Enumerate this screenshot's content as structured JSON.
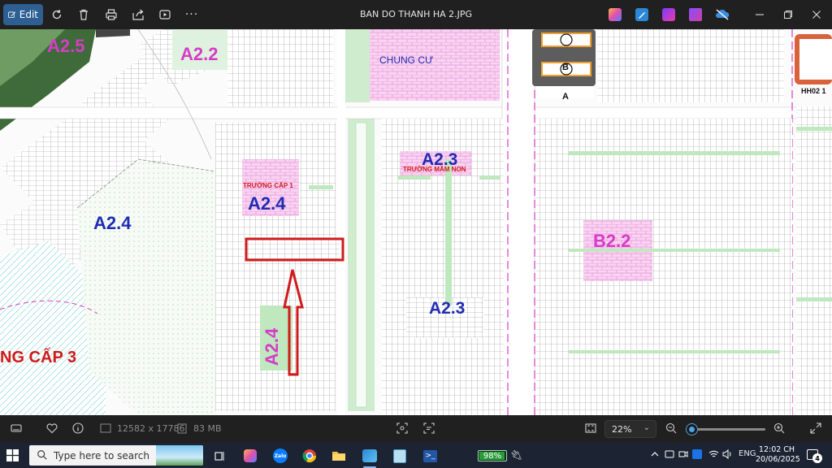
{
  "toolbar": {
    "edit_label": "Edit",
    "file_title": "BAN DO THANH HA 2.JPG",
    "tools": [
      "rotate-icon",
      "delete-icon",
      "print-icon",
      "share-icon",
      "slideshow-icon",
      "more-icon"
    ],
    "more_label": "···"
  },
  "map": {
    "zone_labels": [
      {
        "text": "A2.5",
        "color": "#d63cc7"
      },
      {
        "text": "A2.2",
        "color": "#d63cc7"
      },
      {
        "text": "CHUNG CƯ",
        "color": "#1f2bb3"
      },
      {
        "text": "A2.3",
        "color": "#1f2bb3"
      },
      {
        "text": "TRƯỜNG MẦM NON",
        "color": "#d11a1a"
      },
      {
        "text": "TRƯỜNG CẤP 1",
        "color": "#d11a1a"
      },
      {
        "text": "A2.4",
        "color": "#1f2bb3"
      },
      {
        "text": "A2.4",
        "color": "#1f2bb3"
      },
      {
        "text": "B2.2",
        "color": "#d63cc7"
      },
      {
        "text": "A2.3",
        "color": "#1f2bb3"
      },
      {
        "text": "A2.4",
        "color": "#d63cc7"
      },
      {
        "text": "NG CẤP 3",
        "color": "#d11a1a"
      }
    ],
    "buildings": {
      "b": "B",
      "a": "A",
      "hh": "HH02 1"
    }
  },
  "status": {
    "dimensions": "12582 x 17786",
    "file_size": "83 MB",
    "zoom": "22%",
    "zoom_level": 0.05
  },
  "taskbar": {
    "search_placeholder": "Type here to search",
    "battery": "98%",
    "battery_level": 0.98,
    "language": "ENG",
    "time": "12:02 CH",
    "date": "20/06/2025",
    "notifications": "4"
  }
}
